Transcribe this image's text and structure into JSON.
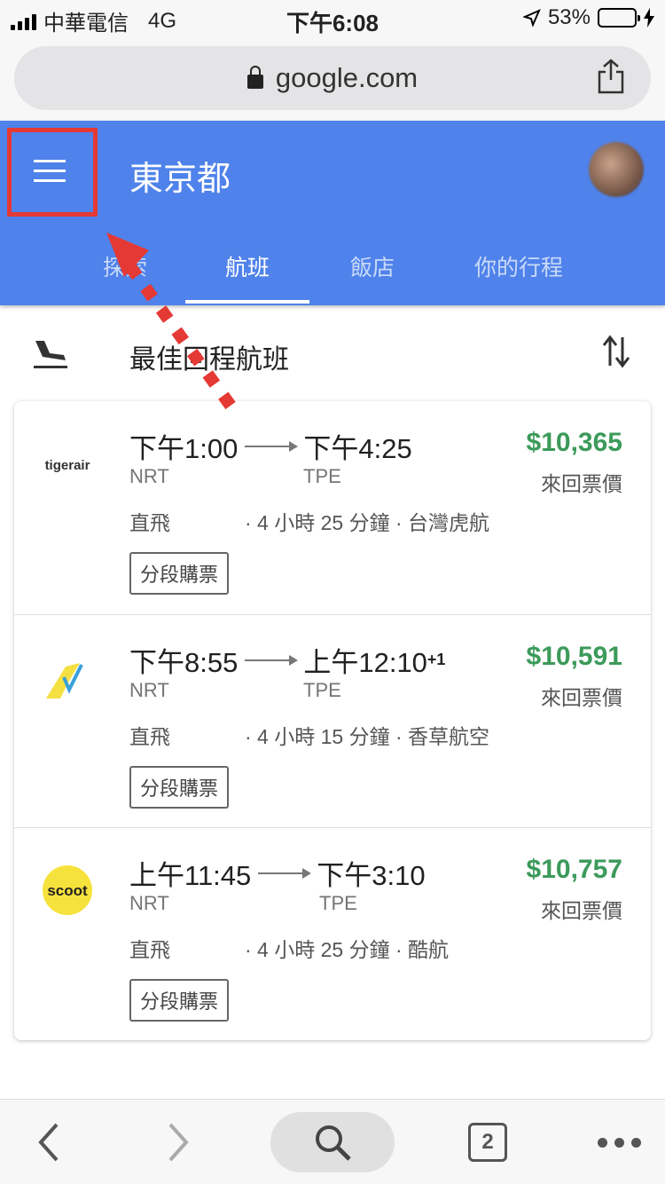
{
  "status": {
    "carrier": "中華電信",
    "network": "4G",
    "time": "下午6:08",
    "battery": "53%",
    "battery_level": 0.53
  },
  "browser": {
    "url": "google.com"
  },
  "header": {
    "title": "東京都",
    "tabs": [
      {
        "label": "探索"
      },
      {
        "label": "航班"
      },
      {
        "label": "飯店"
      },
      {
        "label": "你的行程"
      }
    ],
    "active_tab": "航班"
  },
  "section": {
    "title": "最佳回程航班"
  },
  "flights": [
    {
      "airline_logo": "tigerair",
      "depart_time": "下午1:00",
      "arrive_time": "下午4:25",
      "day_offset": "",
      "from": "NRT",
      "to": "TPE",
      "stops": "直飛",
      "duration_airline": "· 4 小時 25 分鐘 · 台灣虎航",
      "separate_tickets": "分段購票",
      "price": "$10,365",
      "price_label": "來回票價"
    },
    {
      "airline_logo": "vanilla-air-icon",
      "depart_time": "下午8:55",
      "arrive_time": "上午12:10",
      "day_offset": "+1",
      "from": "NRT",
      "to": "TPE",
      "stops": "直飛",
      "duration_airline": "· 4 小時 15 分鐘 · 香草航空",
      "separate_tickets": "分段購票",
      "price": "$10,591",
      "price_label": "來回票價"
    },
    {
      "airline_logo": "scoot",
      "depart_time": "上午11:45",
      "arrive_time": "下午3:10",
      "day_offset": "",
      "from": "NRT",
      "to": "TPE",
      "stops": "直飛",
      "duration_airline": "· 4 小時 25 分鐘 · 酷航",
      "separate_tickets": "分段購票",
      "price": "$10,757",
      "price_label": "來回票價"
    }
  ],
  "toolbar": {
    "tab_count": "2"
  },
  "colors": {
    "header_blue": "#4f82ea",
    "price_green": "#3c9a5a",
    "annotation_red": "#e53935"
  }
}
